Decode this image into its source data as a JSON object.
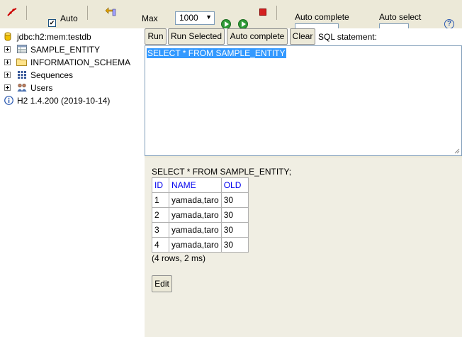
{
  "toolbar": {
    "auto_commit_label": "Auto",
    "max_label": "Max",
    "max_rows_value": "1000",
    "auto_complete_label": "Auto complete",
    "auto_select_label": "Auto select"
  },
  "tree": {
    "connection": "jdbc:h2:mem:testdb",
    "items": [
      {
        "label": "SAMPLE_ENTITY",
        "icon": "table-icon"
      },
      {
        "label": "INFORMATION_SCHEMA",
        "icon": "folder-icon"
      },
      {
        "label": "Sequences",
        "icon": "sequences-icon"
      },
      {
        "label": "Users",
        "icon": "users-icon"
      }
    ],
    "version": "H2 1.4.200 (2019-10-14)"
  },
  "query_bar": {
    "run": "Run",
    "run_selected": "Run Selected",
    "auto_complete": "Auto complete",
    "clear": "Clear",
    "sql_statement_label": "SQL statement:"
  },
  "editor": {
    "sql": "SELECT * FROM SAMPLE_ENTITY"
  },
  "results": {
    "executed_sql": "SELECT * FROM SAMPLE_ENTITY;",
    "columns": [
      "ID",
      "NAME",
      "OLD"
    ],
    "rows": [
      [
        "1",
        "yamada,taro",
        "30"
      ],
      [
        "2",
        "yamada,taro",
        "30"
      ],
      [
        "3",
        "yamada,taro",
        "30"
      ],
      [
        "4",
        "yamada,taro",
        "30"
      ]
    ],
    "summary": "(4 rows, 2 ms)",
    "edit_label": "Edit"
  },
  "colors": {
    "chrome": "#ece9d8",
    "selection": "#3399ff",
    "header_link": "#0000ee"
  }
}
